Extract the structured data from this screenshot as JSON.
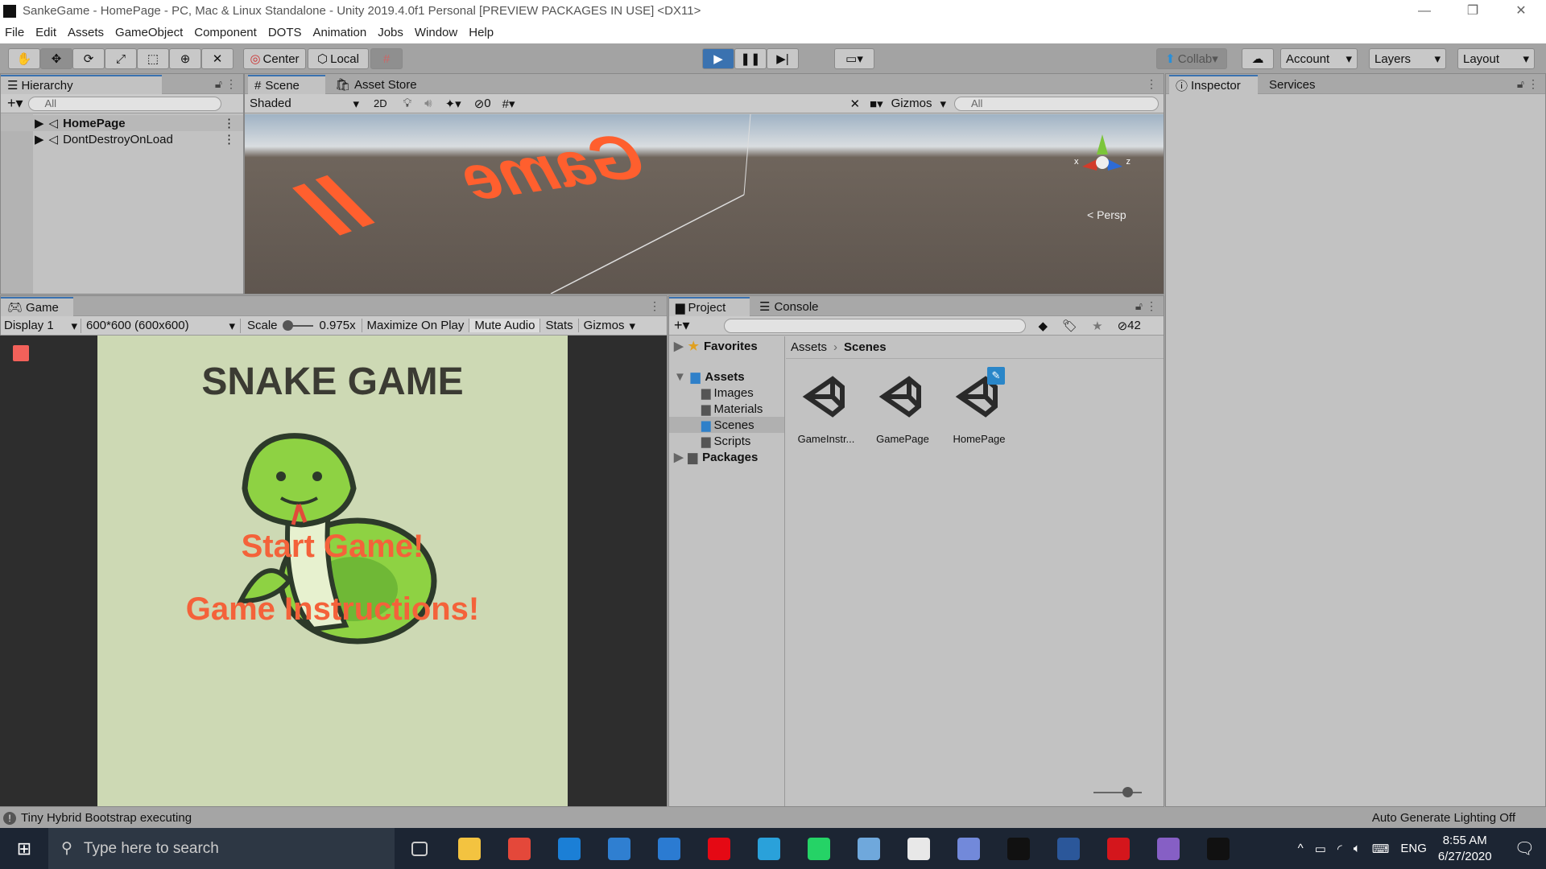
{
  "window": {
    "title": "SankeGame - HomePage - PC, Mac & Linux Standalone - Unity 2019.4.0f1 Personal [PREVIEW PACKAGES IN USE] <DX11>",
    "minimize": "—",
    "restore": "❐",
    "close": "✕"
  },
  "menu": [
    "File",
    "Edit",
    "Assets",
    "GameObject",
    "Component",
    "DOTS",
    "Animation",
    "Jobs",
    "Window",
    "Help"
  ],
  "toolbar": {
    "center": "Center",
    "local": "Local",
    "collab": "Collab",
    "account": "Account",
    "layers": "Layers",
    "layout": "Layout"
  },
  "hierarchy": {
    "tab": "Hierarchy",
    "search_placeholder": "All",
    "items": [
      "HomePage",
      "DontDestroyOnLoad"
    ]
  },
  "scene": {
    "tabs": [
      "Scene",
      "Asset Store"
    ],
    "shading": "Shaded",
    "mode_2d": "2D",
    "hidden_count": "0",
    "gizmos": "Gizmos",
    "search_placeholder": "All",
    "persp": "< Persp",
    "axis_x": "x",
    "axis_z": "z",
    "world_text_1": "Game",
    "world_text_2": "II"
  },
  "inspector": {
    "tabs": [
      "Inspector",
      "Services"
    ]
  },
  "game": {
    "tab": "Game",
    "display": "Display 1",
    "resolution": "600*600 (600x600)",
    "scale_label": "Scale",
    "scale_value": "0.975x",
    "scale_fraction": 0.975,
    "maximize": "Maximize On Play",
    "mute": "Mute Audio",
    "stats": "Stats",
    "gizmos": "Gizmos",
    "title": "SNAKE GAME",
    "start": "Start Game!",
    "instructions": "Game Instructions!"
  },
  "project": {
    "tabs": [
      "Project",
      "Console"
    ],
    "hidden_count": "42",
    "favorites": "Favorites",
    "assets": "Assets",
    "folders": [
      "Images",
      "Materials",
      "Scenes",
      "Scripts"
    ],
    "packages": "Packages",
    "breadcrumb": [
      "Assets",
      "Scenes"
    ],
    "files": [
      "GameInstr...",
      "GamePage",
      "HomePage"
    ]
  },
  "status": {
    "message": "Tiny Hybrid Bootstrap executing",
    "lighting": "Auto Generate Lighting Off"
  },
  "taskbar": {
    "search_placeholder": "Type here to search",
    "time": "8:55 AM",
    "date": "6/27/2020",
    "language": "ENG",
    "apps": [
      "task-view",
      "file-explorer",
      "chrome",
      "edge",
      "store",
      "mail",
      "netflix",
      "telegram",
      "whatsapp",
      "paint",
      "python",
      "discord",
      "unity-hub",
      "word",
      "acrobat",
      "visual-studio",
      "unity"
    ],
    "app_colors": [
      "#1c2533",
      "#f3c340",
      "#e4483a",
      "#1b7fd6",
      "#2f7fd1",
      "#2b7bd2",
      "#e50914",
      "#2aa1da",
      "#25d366",
      "#6fa8dc",
      "#e8e8e8",
      "#7289da",
      "#111111",
      "#2b579a",
      "#d4161c",
      "#865fc5",
      "#111111"
    ]
  },
  "colors": {
    "accent": "#3a72b0",
    "orange": "#f4623a",
    "game_bg": "#cdd9b4"
  }
}
